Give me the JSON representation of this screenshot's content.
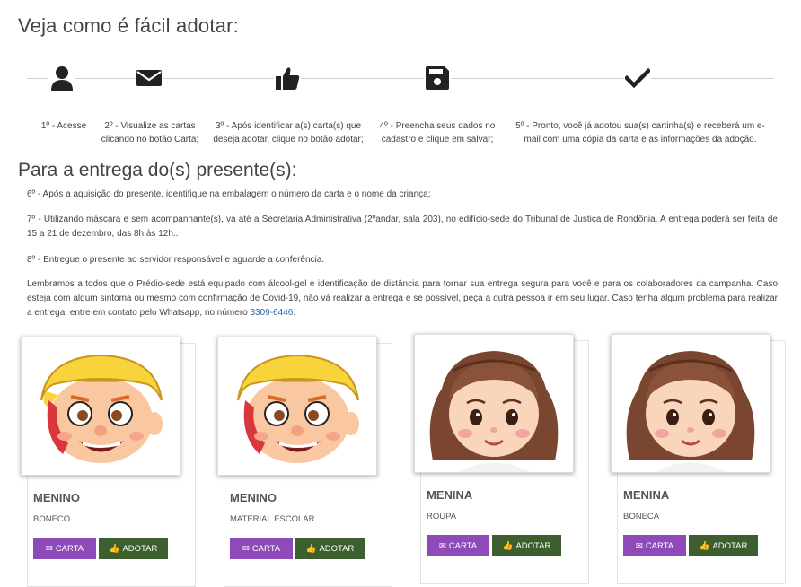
{
  "title": "Veja como é fácil adotar:",
  "steps": [
    {
      "icon": "user-icon",
      "text_lines": [
        "1º - Acesse"
      ]
    },
    {
      "icon": "envelope-icon",
      "text_lines": [
        "2º - Visualize as cartas",
        "clicando no botão Carta;"
      ]
    },
    {
      "icon": "thumbs-up-icon",
      "text_lines": [
        "3º - Após identificar a(s) carta(s) que",
        "deseja adotar, clique no botão adotar;"
      ]
    },
    {
      "icon": "floppy-disk-icon",
      "text_lines": [
        "4º - Preencha seus dados no",
        "cadastro e clique em salvar;"
      ]
    },
    {
      "icon": "checkmark-icon",
      "text_lines": [
        "5º - Pronto, você já adotou sua(s) cartinha(s) e receberá um e-",
        "mail com uma cópia da carta e as informações da adoção."
      ]
    }
  ],
  "delivery_title": "Para a entrega do(s) presente(s):",
  "delivery": {
    "p6": "6º - Após a aquisição do presente, identifique na embalagem o número da carta e o nome da criança;",
    "p7": "7º - Utilizando máscara e sem acompanhante(s), vá até a Secretaria Administrativa (2ºandar, sala 203), no edifício-sede do Tribunal de Justiça de Rondônia. A entrega poderá ser feita de 15 a 21 de dezembro, das 8h às 12h..",
    "p8": "8º - Entregue o presente ao servidor responsável e aguarde a conferência.",
    "p9": "Lembramos a todos que o Prédio-sede está equipado com álcool-gel e identificação de distância para tornar sua entrega segura para você e para os colaboradores da campanha. Caso esteja com algum sintoma ou mesmo com confirmação de Covid-19, não vá realizar a entrega e se possível, peça a outra pessoa ir em seu lugar. Caso tenha algum problema para realizar a entrega, entre em contato pelo Whatsapp, no número ",
    "phone": "3309-6446",
    "p9_end": "."
  },
  "cards": [
    {
      "type": "MENINO",
      "item": "BONECO",
      "avatar": "boy"
    },
    {
      "type": "MENINO",
      "item": "MATERIAL ESCOLAR",
      "avatar": "boy"
    },
    {
      "type": "MENINA",
      "item": "ROUPA",
      "avatar": "girl"
    },
    {
      "type": "MENINA",
      "item": "BONECA",
      "avatar": "girl"
    }
  ],
  "buttons": {
    "carta": "CARTA",
    "adotar": "ADOTAR"
  },
  "colors": {
    "carta": "#8e4ab8",
    "adotar": "#3d5e2e",
    "link": "#2b6cb0"
  }
}
